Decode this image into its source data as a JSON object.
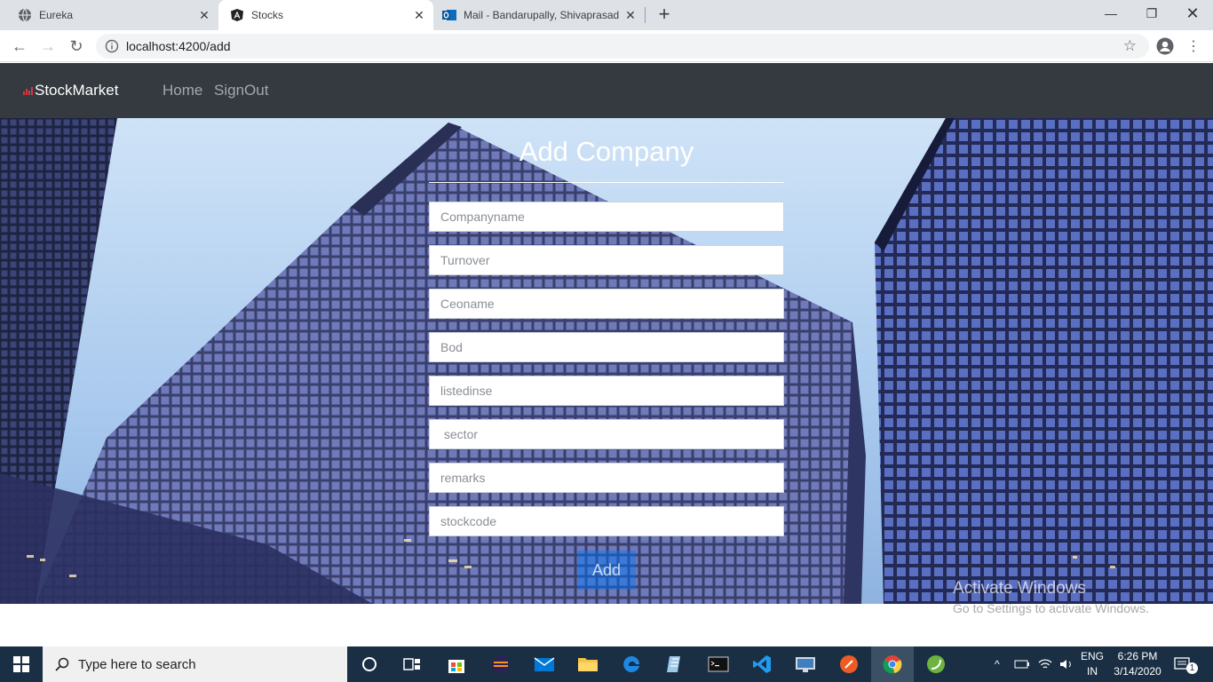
{
  "browser": {
    "tabs": [
      {
        "title": "Eureka",
        "icon": "globe-icon"
      },
      {
        "title": "Stocks",
        "icon": "angular-icon",
        "active": true
      },
      {
        "title": "Mail - Bandarupally, Shivaprasad",
        "icon": "outlook-icon"
      }
    ],
    "url": "localhost:4200/add"
  },
  "app": {
    "brand": "StockMarket",
    "nav": [
      "Home",
      "SignOut"
    ],
    "form_title": "Add Company",
    "fields": [
      {
        "name": "companyname",
        "placeholder": "Companyname"
      },
      {
        "name": "turnover",
        "placeholder": "Turnover"
      },
      {
        "name": "ceoname",
        "placeholder": "Ceoname"
      },
      {
        "name": "bod",
        "placeholder": "Bod"
      },
      {
        "name": "listedinse",
        "placeholder": "listedinse"
      },
      {
        "name": "sector",
        "placeholder": " sector"
      },
      {
        "name": "remarks",
        "placeholder": "remarks"
      },
      {
        "name": "stockcode",
        "placeholder": "stockcode"
      }
    ],
    "submit_label": "Add"
  },
  "watermark": {
    "title": "Activate Windows",
    "subtitle": "Go to Settings to activate Windows."
  },
  "taskbar": {
    "search_placeholder": "Type here to search",
    "lang_top": "ENG",
    "lang_bottom": "IN",
    "time": "6:26 PM",
    "date": "3/14/2020",
    "notification_count": "1"
  },
  "colors": {
    "navbar": "#343a40",
    "button": "#007bff",
    "taskbar": "#1b2f44"
  }
}
